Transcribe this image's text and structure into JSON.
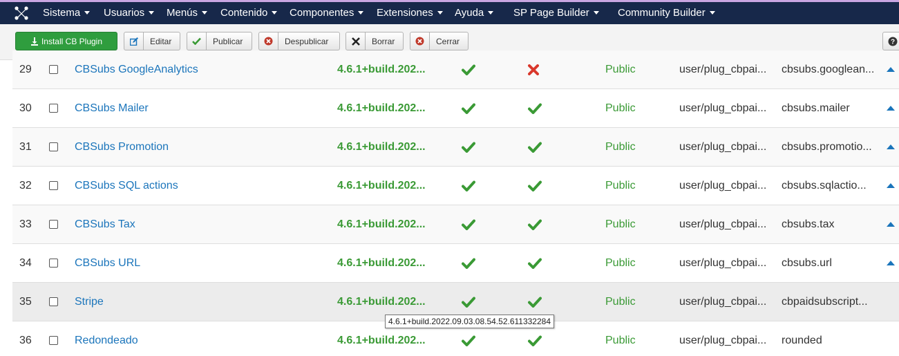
{
  "colors": {
    "navbar": "#17284a",
    "link": "#1b75bb",
    "green": "#3a9a35",
    "red": "#d9382c",
    "install": "#2f9d3e"
  },
  "navbar": {
    "logo_icon": "joomla-logo-icon",
    "menu": [
      {
        "label": "Sistema"
      },
      {
        "label": "Usuarios"
      },
      {
        "label": "Menús"
      },
      {
        "label": "Contenido"
      },
      {
        "label": "Componentes"
      },
      {
        "label": "Extensiones"
      },
      {
        "label": "Ayuda"
      },
      {
        "label": "SP Page Builder"
      },
      {
        "label": "Community Builder"
      }
    ]
  },
  "toolbar": {
    "install_label": "Install CB Plugin",
    "edit_label": "Editar",
    "publish_label": "Publicar",
    "unpublish_label": "Despublicar",
    "delete_label": "Borrar",
    "close_label": "Cerrar",
    "help_label": "?"
  },
  "rows": [
    {
      "num": "29",
      "name": "CBSubs GoogleAnalytics",
      "version": "4.6.1+build.202...",
      "status1": "check",
      "status2": "cross",
      "access": "Public",
      "folder": "user/plug_cbpai...",
      "element": "cbsubs.googlean...",
      "order_up": true
    },
    {
      "num": "30",
      "name": "CBSubs Mailer",
      "version": "4.6.1+build.202...",
      "status1": "check",
      "status2": "check",
      "access": "Public",
      "folder": "user/plug_cbpai...",
      "element": "cbsubs.mailer",
      "order_up": true
    },
    {
      "num": "31",
      "name": "CBSubs Promotion",
      "version": "4.6.1+build.202...",
      "status1": "check",
      "status2": "check",
      "access": "Public",
      "folder": "user/plug_cbpai...",
      "element": "cbsubs.promotio...",
      "order_up": true
    },
    {
      "num": "32",
      "name": "CBSubs SQL actions",
      "version": "4.6.1+build.202...",
      "status1": "check",
      "status2": "check",
      "access": "Public",
      "folder": "user/plug_cbpai...",
      "element": "cbsubs.sqlactio...",
      "order_up": true
    },
    {
      "num": "33",
      "name": "CBSubs Tax",
      "version": "4.6.1+build.202...",
      "status1": "check",
      "status2": "check",
      "access": "Public",
      "folder": "user/plug_cbpai...",
      "element": "cbsubs.tax",
      "order_up": true
    },
    {
      "num": "34",
      "name": "CBSubs URL",
      "version": "4.6.1+build.202...",
      "status1": "check",
      "status2": "check",
      "access": "Public",
      "folder": "user/plug_cbpai...",
      "element": "cbsubs.url",
      "order_up": true
    },
    {
      "num": "35",
      "name": "Stripe",
      "version": "4.6.1+build.202...",
      "status1": "check",
      "status2": "check",
      "access": "Public",
      "folder": "user/plug_cbpai...",
      "element": "cbpaidsubscript...",
      "order_up": false
    },
    {
      "num": "36",
      "name": "Redondeado",
      "version": "4.6.1+build.202...",
      "status1": "check",
      "status2": "check",
      "access": "Public",
      "folder": "user/plug_cbpai...",
      "element": "rounded",
      "order_up": false
    }
  ],
  "tooltip": "4.6.1+build.2022.09.03.08.54.52.611332284"
}
